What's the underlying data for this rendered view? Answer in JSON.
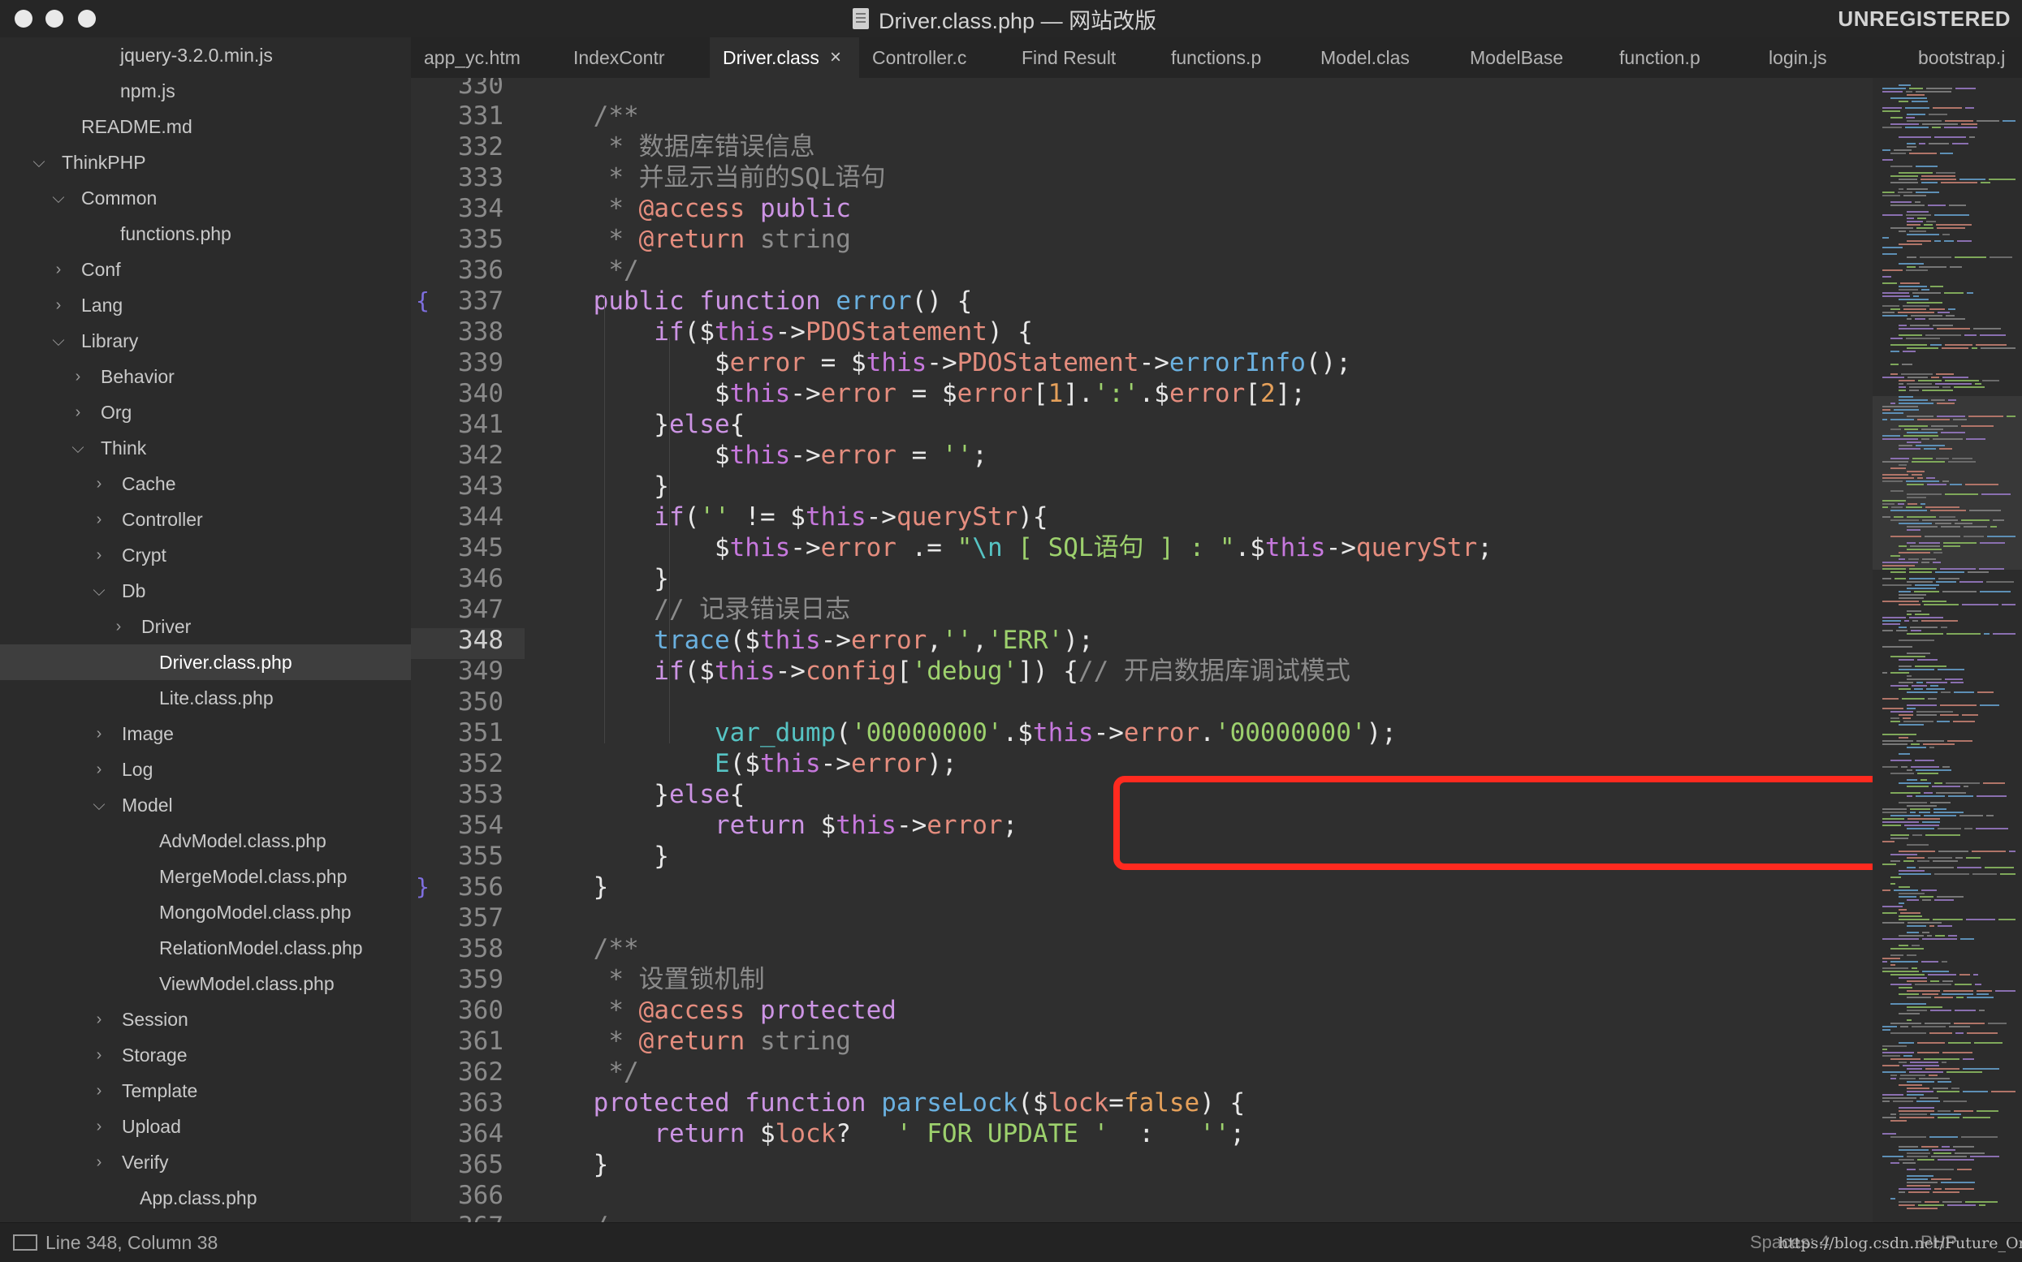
{
  "window": {
    "title": "Driver.class.php — 网站改版",
    "license_label": "UNREGISTERED"
  },
  "sidebar": {
    "items": [
      {
        "label": "jquery-3.2.0.min.js",
        "type": "file",
        "depth": 4
      },
      {
        "label": "npm.js",
        "type": "file",
        "depth": 4
      },
      {
        "label": "README.md",
        "type": "file",
        "depth": 3
      },
      {
        "label": "ThinkPHP",
        "type": "folder",
        "expanded": true,
        "depth": 1
      },
      {
        "label": "Common",
        "type": "folder",
        "expanded": true,
        "depth": 2
      },
      {
        "label": "functions.php",
        "type": "file",
        "depth": 4
      },
      {
        "label": "Conf",
        "type": "folder",
        "expanded": false,
        "depth": 2
      },
      {
        "label": "Lang",
        "type": "folder",
        "expanded": false,
        "depth": 2
      },
      {
        "label": "Library",
        "type": "folder",
        "expanded": true,
        "depth": 2
      },
      {
        "label": "Behavior",
        "type": "folder",
        "expanded": false,
        "depth": 3
      },
      {
        "label": "Org",
        "type": "folder",
        "expanded": false,
        "depth": 3
      },
      {
        "label": "Think",
        "type": "folder",
        "expanded": true,
        "depth": 3
      },
      {
        "label": "Cache",
        "type": "folder",
        "expanded": false,
        "depth": 4
      },
      {
        "label": "Controller",
        "type": "folder",
        "expanded": false,
        "depth": 4
      },
      {
        "label": "Crypt",
        "type": "folder",
        "expanded": false,
        "depth": 4
      },
      {
        "label": "Db",
        "type": "folder",
        "expanded": true,
        "depth": 4
      },
      {
        "label": "Driver",
        "type": "folder",
        "expanded": false,
        "depth": 5
      },
      {
        "label": "Driver.class.php",
        "type": "file",
        "depth": 6,
        "selected": true
      },
      {
        "label": "Lite.class.php",
        "type": "file",
        "depth": 6
      },
      {
        "label": "Image",
        "type": "folder",
        "expanded": false,
        "depth": 4
      },
      {
        "label": "Log",
        "type": "folder",
        "expanded": false,
        "depth": 4
      },
      {
        "label": "Model",
        "type": "folder",
        "expanded": true,
        "depth": 4
      },
      {
        "label": "AdvModel.class.php",
        "type": "file",
        "depth": 6
      },
      {
        "label": "MergeModel.class.php",
        "type": "file",
        "depth": 6
      },
      {
        "label": "MongoModel.class.php",
        "type": "file",
        "depth": 6
      },
      {
        "label": "RelationModel.class.php",
        "type": "file",
        "depth": 6
      },
      {
        "label": "ViewModel.class.php",
        "type": "file",
        "depth": 6
      },
      {
        "label": "Session",
        "type": "folder",
        "expanded": false,
        "depth": 4
      },
      {
        "label": "Storage",
        "type": "folder",
        "expanded": false,
        "depth": 4
      },
      {
        "label": "Template",
        "type": "folder",
        "expanded": false,
        "depth": 4
      },
      {
        "label": "Upload",
        "type": "folder",
        "expanded": false,
        "depth": 4
      },
      {
        "label": "Verify",
        "type": "folder",
        "expanded": false,
        "depth": 4
      },
      {
        "label": "App.class.php",
        "type": "file",
        "depth": 5
      }
    ]
  },
  "tabs": [
    {
      "label": "app_yc.htm",
      "active": false
    },
    {
      "label": "IndexContr",
      "active": false
    },
    {
      "label": "Driver.class",
      "active": true,
      "close": "×"
    },
    {
      "label": "Controller.c",
      "active": false
    },
    {
      "label": "Find Result",
      "active": false
    },
    {
      "label": "functions.p",
      "active": false
    },
    {
      "label": "Model.clas",
      "active": false
    },
    {
      "label": "ModelBase",
      "active": false
    },
    {
      "label": "function.p",
      "active": false
    },
    {
      "label": "login.js",
      "active": false
    },
    {
      "label": "bootstrap.j",
      "active": false
    }
  ],
  "editor": {
    "current_line": 348,
    "lines": [
      {
        "n": "330",
        "tokens": []
      },
      {
        "n": "331",
        "tokens": [
          [
            "c",
            "    /**"
          ]
        ]
      },
      {
        "n": "332",
        "tokens": [
          [
            "c",
            "     * 数据库错误信息"
          ]
        ]
      },
      {
        "n": "333",
        "tokens": [
          [
            "c",
            "     * 并显示当前的SQL语句"
          ]
        ]
      },
      {
        "n": "334",
        "tokens": [
          [
            "c",
            "     * "
          ],
          [
            "ann",
            "@access"
          ],
          [
            "kw",
            " public"
          ]
        ]
      },
      {
        "n": "335",
        "tokens": [
          [
            "c",
            "     * "
          ],
          [
            "ann",
            "@return"
          ],
          [
            "c",
            " string"
          ]
        ]
      },
      {
        "n": "336",
        "tokens": [
          [
            "c",
            "     */"
          ]
        ]
      },
      {
        "n": "337",
        "fold": "{",
        "tokens": [
          [
            "kw",
            "    public function "
          ],
          [
            "fn",
            "error"
          ],
          [
            "p",
            "() {"
          ]
        ]
      },
      {
        "n": "338",
        "tokens": [
          [
            "kw",
            "        if"
          ],
          [
            "p",
            "("
          ],
          [
            "p",
            "$"
          ],
          [
            "th",
            "this"
          ],
          [
            "p",
            "->"
          ],
          [
            "pr",
            "PDOStatement"
          ],
          [
            "p",
            ") {"
          ]
        ]
      },
      {
        "n": "339",
        "tokens": [
          [
            "p",
            "            $"
          ],
          [
            "v",
            "error"
          ],
          [
            "p",
            " = $"
          ],
          [
            "th",
            "this"
          ],
          [
            "p",
            "->"
          ],
          [
            "pr",
            "PDOStatement"
          ],
          [
            "p",
            "->"
          ],
          [
            "fn",
            "errorInfo"
          ],
          [
            "p",
            "();"
          ]
        ]
      },
      {
        "n": "340",
        "tokens": [
          [
            "p",
            "            $"
          ],
          [
            "th",
            "this"
          ],
          [
            "p",
            "->"
          ],
          [
            "pr",
            "error"
          ],
          [
            "p",
            " = $"
          ],
          [
            "v",
            "error"
          ],
          [
            "p",
            "["
          ],
          [
            "num",
            "1"
          ],
          [
            "p",
            "]."
          ],
          [
            "s",
            "':'"
          ],
          [
            "p",
            ".$"
          ],
          [
            "v",
            "error"
          ],
          [
            "p",
            "["
          ],
          [
            "num",
            "2"
          ],
          [
            "p",
            "];"
          ]
        ]
      },
      {
        "n": "341",
        "tokens": [
          [
            "p",
            "        }"
          ],
          [
            "kw",
            "else"
          ],
          [
            "p",
            "{"
          ]
        ]
      },
      {
        "n": "342",
        "tokens": [
          [
            "p",
            "            $"
          ],
          [
            "th",
            "this"
          ],
          [
            "p",
            "->"
          ],
          [
            "pr",
            "error"
          ],
          [
            "p",
            " = "
          ],
          [
            "s",
            "''"
          ],
          [
            "p",
            ";"
          ]
        ]
      },
      {
        "n": "343",
        "tokens": [
          [
            "p",
            "        }"
          ]
        ]
      },
      {
        "n": "344",
        "tokens": [
          [
            "kw",
            "        if"
          ],
          [
            "p",
            "("
          ],
          [
            "s",
            "''"
          ],
          [
            "p",
            " != $"
          ],
          [
            "th",
            "this"
          ],
          [
            "p",
            "->"
          ],
          [
            "pr",
            "queryStr"
          ],
          [
            "p",
            "){"
          ]
        ]
      },
      {
        "n": "345",
        "tokens": [
          [
            "p",
            "            $"
          ],
          [
            "th",
            "this"
          ],
          [
            "p",
            "->"
          ],
          [
            "pr",
            "error"
          ],
          [
            "p",
            " .= "
          ],
          [
            "s",
            "\""
          ],
          [
            "cy",
            "\\n"
          ],
          [
            "s",
            " [ SQL语句 ] : "
          ],
          [
            "s",
            "\""
          ],
          [
            "p",
            ".$"
          ],
          [
            "th",
            "this"
          ],
          [
            "p",
            "->"
          ],
          [
            "pr",
            "queryStr"
          ],
          [
            "p",
            ";"
          ]
        ]
      },
      {
        "n": "346",
        "tokens": [
          [
            "p",
            "        }"
          ]
        ]
      },
      {
        "n": "347",
        "tokens": [
          [
            "c",
            "        // 记录错误日志"
          ]
        ]
      },
      {
        "n": "348",
        "tokens": [
          [
            "fn",
            "        trace"
          ],
          [
            "p",
            "($"
          ],
          [
            "th",
            "this"
          ],
          [
            "p",
            "->"
          ],
          [
            "pr",
            "error"
          ],
          [
            "p",
            ","
          ],
          [
            "s",
            "''"
          ],
          [
            "p",
            ","
          ],
          [
            "s",
            "'ERR'"
          ],
          [
            "p",
            ");"
          ]
        ]
      },
      {
        "n": "349",
        "tokens": [
          [
            "kw",
            "        if"
          ],
          [
            "p",
            "($"
          ],
          [
            "th",
            "this"
          ],
          [
            "p",
            "->"
          ],
          [
            "pr",
            "config"
          ],
          [
            "p",
            "["
          ],
          [
            "s",
            "'debug'"
          ],
          [
            "p",
            "]) {"
          ],
          [
            "c",
            "// 开启数据库调试模式"
          ]
        ]
      },
      {
        "n": "350",
        "tokens": []
      },
      {
        "n": "351",
        "tokens": [
          [
            "cy",
            "            var_dump"
          ],
          [
            "p",
            "("
          ],
          [
            "s",
            "'00000000'"
          ],
          [
            "p",
            ".$"
          ],
          [
            "th",
            "this"
          ],
          [
            "p",
            "->"
          ],
          [
            "pr",
            "error"
          ],
          [
            "p",
            "."
          ],
          [
            "s",
            "'00000000'"
          ],
          [
            "p",
            ");"
          ]
        ]
      },
      {
        "n": "352",
        "tokens": [
          [
            "cy",
            "            E"
          ],
          [
            "p",
            "($"
          ],
          [
            "th",
            "this"
          ],
          [
            "p",
            "->"
          ],
          [
            "pr",
            "error"
          ],
          [
            "p",
            ");"
          ]
        ]
      },
      {
        "n": "353",
        "tokens": [
          [
            "p",
            "        }"
          ],
          [
            "kw",
            "else"
          ],
          [
            "p",
            "{"
          ]
        ]
      },
      {
        "n": "354",
        "tokens": [
          [
            "kw",
            "            return"
          ],
          [
            "p",
            " $"
          ],
          [
            "th",
            "this"
          ],
          [
            "p",
            "->"
          ],
          [
            "pr",
            "error"
          ],
          [
            "p",
            ";"
          ]
        ]
      },
      {
        "n": "355",
        "tokens": [
          [
            "p",
            "        }"
          ]
        ]
      },
      {
        "n": "356",
        "fold": "}",
        "tokens": [
          [
            "p",
            "    }"
          ]
        ]
      },
      {
        "n": "357",
        "tokens": []
      },
      {
        "n": "358",
        "tokens": [
          [
            "c",
            "    /**"
          ]
        ]
      },
      {
        "n": "359",
        "tokens": [
          [
            "c",
            "     * 设置锁机制"
          ]
        ]
      },
      {
        "n": "360",
        "tokens": [
          [
            "c",
            "     * "
          ],
          [
            "ann",
            "@access"
          ],
          [
            "kw",
            " protected"
          ]
        ]
      },
      {
        "n": "361",
        "tokens": [
          [
            "c",
            "     * "
          ],
          [
            "ann",
            "@return"
          ],
          [
            "c",
            " string"
          ]
        ]
      },
      {
        "n": "362",
        "tokens": [
          [
            "c",
            "     */"
          ]
        ]
      },
      {
        "n": "363",
        "tokens": [
          [
            "kw",
            "    protected function "
          ],
          [
            "fn",
            "parseLock"
          ],
          [
            "p",
            "($"
          ],
          [
            "v",
            "lock"
          ],
          [
            "p",
            "="
          ],
          [
            "num",
            "false"
          ],
          [
            "p",
            ") {"
          ]
        ]
      },
      {
        "n": "364",
        "tokens": [
          [
            "kw",
            "        return"
          ],
          [
            "p",
            " $"
          ],
          [
            "v",
            "lock"
          ],
          [
            "p",
            "?   "
          ],
          [
            "s",
            "' FOR UPDATE '"
          ],
          [
            "p",
            "  :   "
          ],
          [
            "s",
            "''"
          ],
          [
            "p",
            ";"
          ]
        ]
      },
      {
        "n": "365",
        "tokens": [
          [
            "p",
            "    }"
          ]
        ]
      },
      {
        "n": "366",
        "tokens": []
      },
      {
        "n": "367",
        "tokens": [
          [
            "c",
            "    /"
          ]
        ]
      }
    ]
  },
  "statusbar": {
    "position": "Line 348, Column 38",
    "indent": "Spaces: 4",
    "syntax": "PHP",
    "watermark": "https://blog.csdn.net/Future_One"
  },
  "colors": {
    "highlight_box": "#ff2a1f",
    "keyword": "#cc94e4",
    "function": "#6ab0df",
    "variable": "#e58d7e",
    "string": "#9dd16d",
    "comment": "#8b8b8b"
  }
}
